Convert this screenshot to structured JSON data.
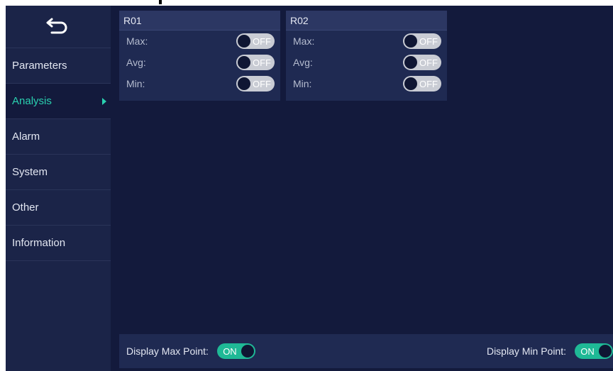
{
  "sidebar": {
    "back_icon": "back-arrow-icon",
    "items": [
      {
        "label": "Parameters",
        "active": false
      },
      {
        "label": "Analysis",
        "active": true
      },
      {
        "label": "Alarm",
        "active": false
      },
      {
        "label": "System",
        "active": false
      },
      {
        "label": "Other",
        "active": false
      },
      {
        "label": "Information",
        "active": false
      }
    ]
  },
  "rois": [
    {
      "title": "R01",
      "rows": [
        {
          "label": "Max:",
          "state": "OFF"
        },
        {
          "label": "Avg:",
          "state": "OFF"
        },
        {
          "label": "Min:",
          "state": "OFF"
        }
      ]
    },
    {
      "title": "R02",
      "rows": [
        {
          "label": "Max:",
          "state": "OFF"
        },
        {
          "label": "Avg:",
          "state": "OFF"
        },
        {
          "label": "Min:",
          "state": "OFF"
        }
      ]
    }
  ],
  "bottom": {
    "max_label": "Display Max Point:",
    "max_state": "ON",
    "min_label": "Display Min Point:",
    "min_state": "ON"
  },
  "colors": {
    "accent": "#2ad1b0",
    "toggle_on": "#1fb996",
    "toggle_off": "#c9ccd4",
    "background": "#131a3c",
    "sidebar": "#1b2448",
    "panel": "#1f2a52"
  }
}
